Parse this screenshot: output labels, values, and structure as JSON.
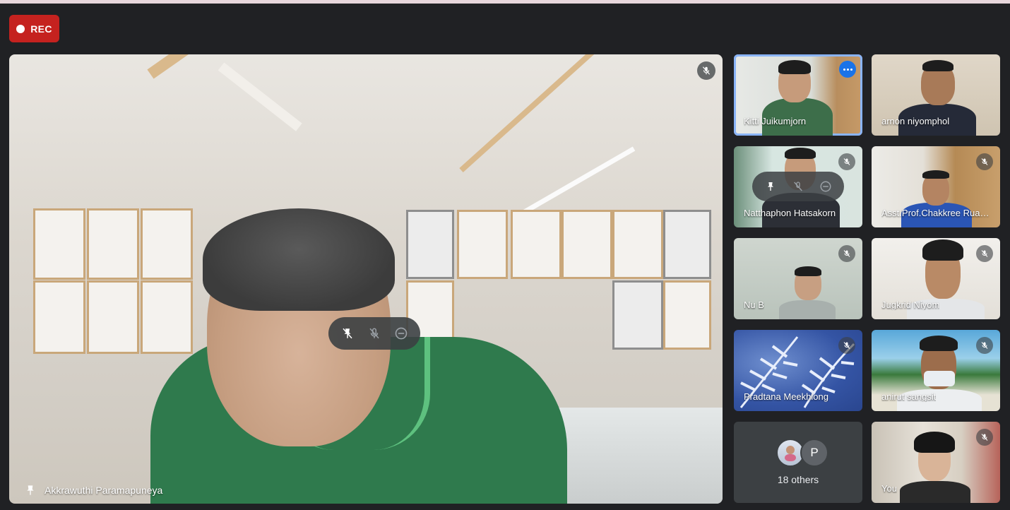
{
  "recording": {
    "label": "REC",
    "color": "#c5221f"
  },
  "main_speaker": {
    "name": "Akkrawuthi Paramapuneya",
    "hover_controls": [
      "pin-icon",
      "mic-off-icon",
      "remove-icon"
    ],
    "status_icon": "mic-off-icon"
  },
  "tiles": [
    {
      "name": "Kitti Juikumjorn",
      "status_icon": "more-options-icon",
      "selected": true
    },
    {
      "name": "arnon niyomphol",
      "status_icon": ""
    },
    {
      "name": "Natthaphon Hatsakorn",
      "status_icon": "mic-off-icon",
      "hover_controls": [
        "pin-icon",
        "mic-off-icon",
        "remove-icon"
      ]
    },
    {
      "name": "Asst.Prof.Chakkree Ruamchao",
      "status_icon": "mic-off-icon"
    },
    {
      "name": "Nu B",
      "status_icon": "mic-off-icon"
    },
    {
      "name": "Jugkrid Niyom",
      "status_icon": "mic-off-icon"
    },
    {
      "name": "Pradtana Meekhlong",
      "status_icon": "mic-off-icon"
    },
    {
      "name": "anirut sangsit",
      "status_icon": "mic-off-icon"
    },
    {
      "name": "You",
      "status_icon": "mic-off-icon"
    }
  ],
  "others": {
    "avatar_letter": "P",
    "label": "18 others"
  },
  "colors": {
    "background": "#202124",
    "selected_outline": "#8ab4f8",
    "accent": "#1a73e8"
  }
}
